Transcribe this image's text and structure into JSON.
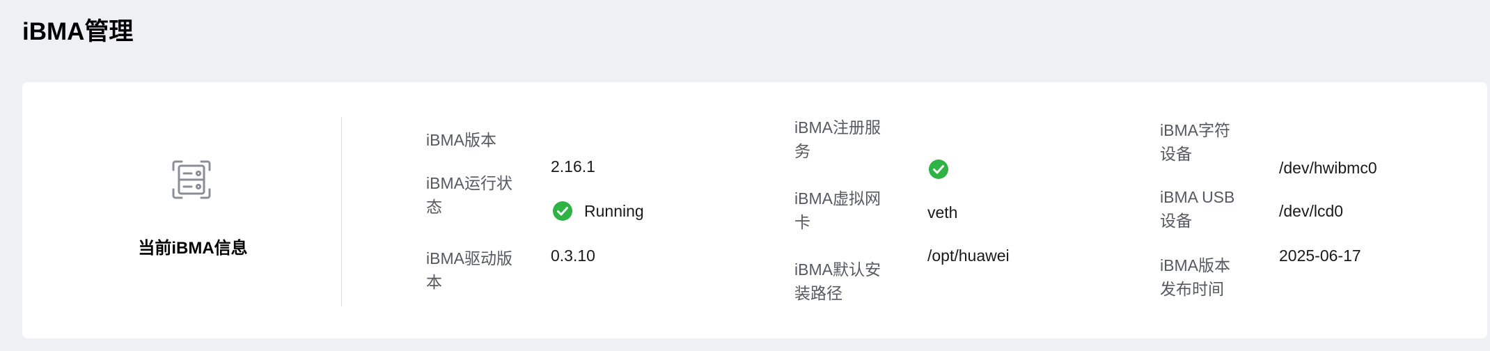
{
  "page": {
    "title": "iBMA管理"
  },
  "summary": {
    "label": "当前iBMA信息",
    "icon": "server-info-icon"
  },
  "columns": [
    {
      "fields": [
        {
          "label_lines": [
            "iBMA版本"
          ],
          "value": "2.16.1"
        },
        {
          "label_lines": [
            "iBMA运行状",
            "态"
          ],
          "value": "Running",
          "status_icon": "check-circle-icon"
        },
        {
          "label_lines": [
            "iBMA驱动版",
            "本"
          ],
          "value": "0.3.10"
        }
      ]
    },
    {
      "fields": [
        {
          "label_lines": [
            "iBMA注册服",
            "务"
          ],
          "value": "",
          "status_icon": "check-circle-icon"
        },
        {
          "label_lines": [
            "iBMA虚拟网",
            "卡"
          ],
          "value": "veth"
        },
        {
          "label_lines": [
            "iBMA默认安",
            "装路径"
          ],
          "value": "/opt/huawei"
        }
      ]
    },
    {
      "fields": [
        {
          "label_lines": [
            "iBMA字符",
            "设备"
          ],
          "value": "/dev/hwibmc0"
        },
        {
          "label_lines": [
            "iBMA USB",
            "设备"
          ],
          "value": "/dev/lcd0"
        },
        {
          "label_lines": [
            "iBMA版本",
            "发布时间"
          ],
          "value": "2025-06-17"
        }
      ]
    }
  ],
  "colors": {
    "background": "#eef0f4",
    "card": "#ffffff",
    "status_ok": "#2fb344",
    "label": "#56595f"
  }
}
